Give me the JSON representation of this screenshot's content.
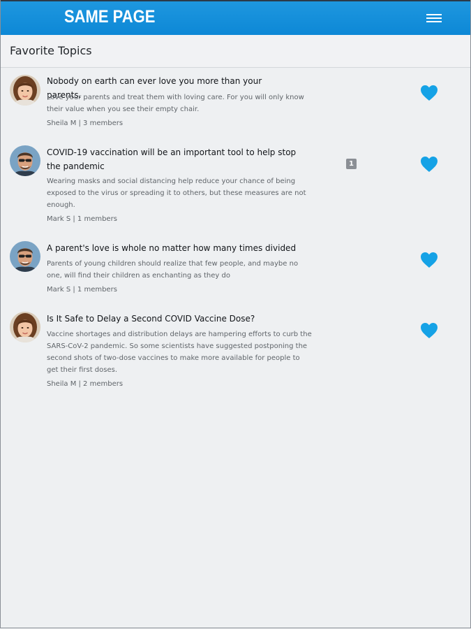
{
  "app": {
    "brand": "SAME PAGE",
    "menu_icon": "hamburger-menu-icon"
  },
  "section": {
    "title": "Favorite Topics"
  },
  "colors": {
    "accent": "#0d88d6",
    "heart": "#15a2e6",
    "background": "#eef0f2"
  },
  "topics": [
    {
      "title": "Nobody on earth can ever love you more than your parents.",
      "description": "Love your parents and treat them with loving care. For you will only know their value when you see their empty chair.",
      "meta": "Sheila M | 3 members",
      "avatar": "woman-avatar",
      "favorited": true
    },
    {
      "title": "COVID-19 vaccination will be an important tool to help stop the pandemic",
      "description": "Wearing masks and social distancing help reduce your chance of being exposed to the virus or spreading it to others, but these measures are not enough.",
      "meta": "Mark S | 1 members",
      "avatar": "man-avatar",
      "badge": "1",
      "favorited": true
    },
    {
      "title": "A parent's love is whole no matter how many times divided",
      "description": "Parents of young children should realize that few people, and maybe no one, will find their children as enchanting as they do",
      "meta": "Mark S | 1 members",
      "avatar": "man-avatar",
      "favorited": true
    },
    {
      "title": "Is It Safe to Delay a Second COVID Vaccine Dose?",
      "description": "Vaccine shortages and distribution delays are hampering efforts to curb the SARS-CoV-2 pandemic. So some scientists have suggested postponing the second shots of two-dose vaccines to make more available for people to get their first doses.",
      "meta": "Sheila M | 2 members",
      "avatar": "woman-avatar",
      "favorited": true
    }
  ]
}
